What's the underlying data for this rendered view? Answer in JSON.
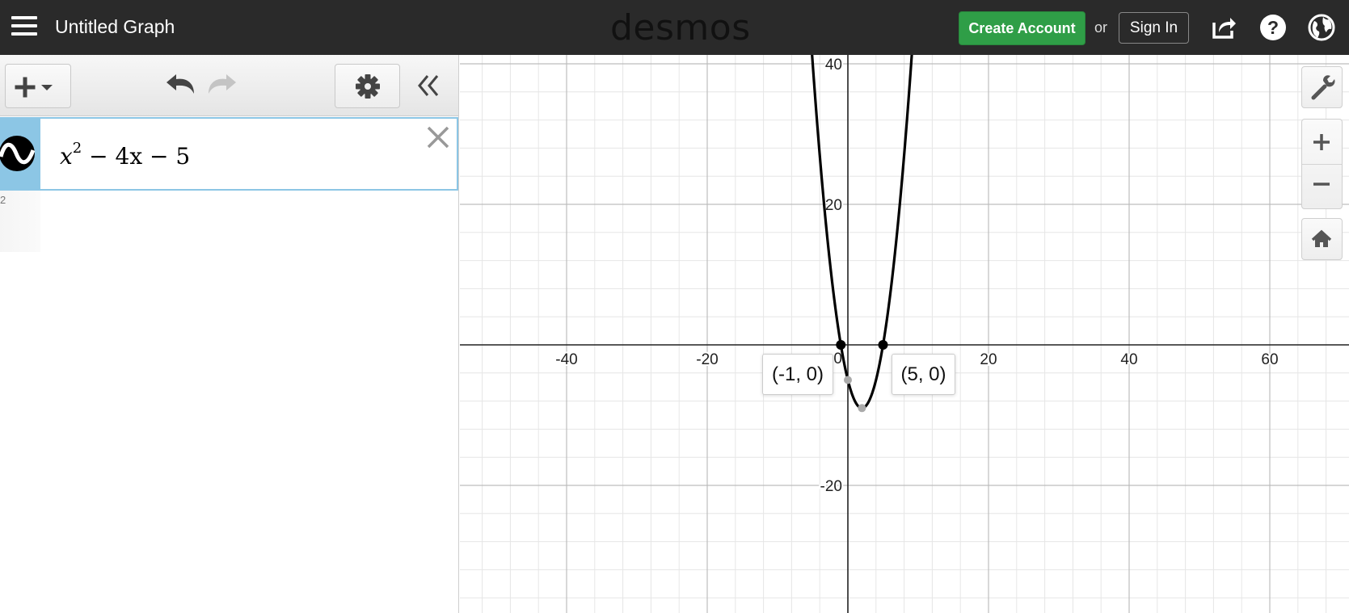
{
  "header": {
    "title": "Untitled Graph",
    "logo": "desmos",
    "create_account": "Create Account",
    "or": "or",
    "sign_in": "Sign In",
    "icons": [
      "menu-icon",
      "share-icon",
      "help-icon",
      "globe-icon"
    ],
    "bg_color": "#2a2a2a",
    "accent_color": "#2f9e47"
  },
  "expressions": [
    {
      "index": "1",
      "latex": "x^2 - 4x - 5",
      "display": {
        "base": "x",
        "exp": "2",
        "rest": " − 4x − 5"
      },
      "color": "#000000",
      "tab_color": "#8cc6e5"
    },
    {
      "index": "2",
      "latex": ""
    }
  ],
  "graph": {
    "x_ticks": [
      "-40",
      "-20",
      "0",
      "20",
      "40",
      "60"
    ],
    "y_ticks": [
      "40",
      "20",
      "-20"
    ],
    "point_labels": [
      "(-1, 0)",
      "(5, 0)"
    ],
    "curve_color": "#000000"
  },
  "chart_data": {
    "type": "line",
    "function": "x^2 - 4x - 5",
    "xlim": [
      -55,
      72
    ],
    "ylim": [
      -38,
      41
    ],
    "x_tick_values": [
      -40,
      -20,
      0,
      20,
      40,
      60
    ],
    "y_tick_values": [
      -20,
      20,
      40
    ],
    "grid": true,
    "highlighted_points": [
      {
        "x": -1,
        "y": 0,
        "label": "(-1, 0)",
        "kind": "root"
      },
      {
        "x": 5,
        "y": 0,
        "label": "(5, 0)",
        "kind": "root"
      },
      {
        "x": 2,
        "y": -9,
        "kind": "vertex"
      },
      {
        "x": 0,
        "y": -5,
        "kind": "y-intercept"
      }
    ]
  }
}
